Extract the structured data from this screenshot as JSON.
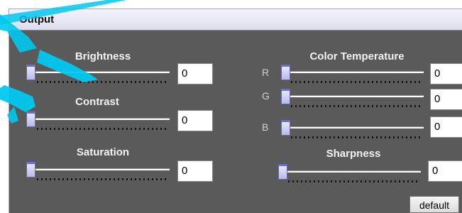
{
  "panel": {
    "title": "Output"
  },
  "controls": {
    "brightness": {
      "label": "Brightness",
      "value": "0"
    },
    "contrast": {
      "label": "Contrast",
      "value": "0"
    },
    "saturation": {
      "label": "Saturation",
      "value": "0"
    },
    "color_temperature": {
      "label": "Color Temperature",
      "r": {
        "label": "R",
        "value": "0"
      },
      "g": {
        "label": "G",
        "value": "0"
      },
      "b": {
        "label": "B",
        "value": "0"
      }
    },
    "sharpness": {
      "label": "Sharpness",
      "value": "0"
    }
  },
  "buttons": {
    "default_label": "default"
  },
  "colors": {
    "panel_bg": "#5a5a5a",
    "titlebar_bg": "#eaeaf6",
    "thumb_accent": "#6b6bdc",
    "watermark": "#00c8f0"
  }
}
